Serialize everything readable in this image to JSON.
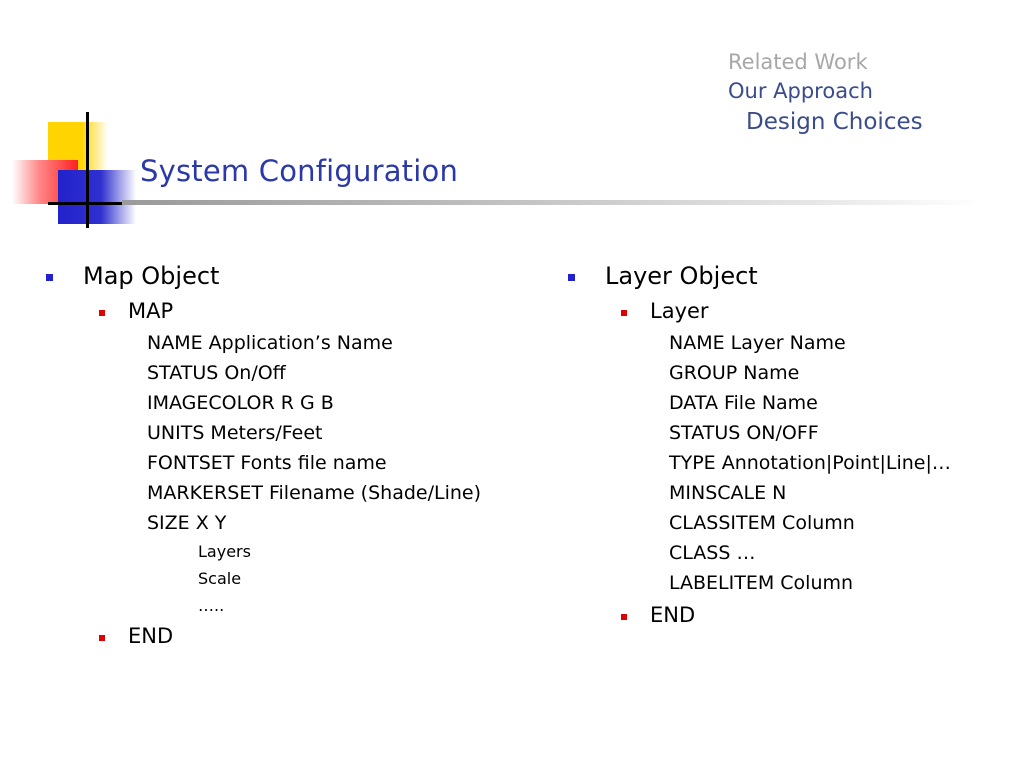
{
  "nav": {
    "related_work": "Related Work",
    "our_approach": "Our Approach",
    "design_choices": "Design Choices"
  },
  "title": "System Configuration",
  "left": {
    "heading": "Map Object",
    "sub": "MAP",
    "fields": [
      "NAME  Application’s Name",
      "STATUS On/Off",
      "IMAGECOLOR R G B",
      "UNITS Meters/Feet",
      "FONTSET Fonts file name",
      "MARKERSET Filename (Shade/Line)",
      "SIZE X Y"
    ],
    "subitems": [
      "Layers",
      "Scale",
      "….."
    ],
    "end": "END"
  },
  "right": {
    "heading": "Layer Object",
    "sub": "Layer",
    "fields": [
      "NAME  Layer Name",
      "GROUP Name",
      "DATA File Name",
      "STATUS ON/OFF",
      "TYPE Annotation|Point|Line|…",
      "MINSCALE N",
      "CLASSITEM Column",
      "CLASS …",
      "LABELITEM Column"
    ],
    "end": "END"
  },
  "colors": {
    "title": "#2a38a8",
    "nav_active": "#3a4c8a",
    "nav_inactive": "#a7a7a7",
    "bullet_level1": "#2222cc",
    "bullet_level2": "#e00000"
  }
}
